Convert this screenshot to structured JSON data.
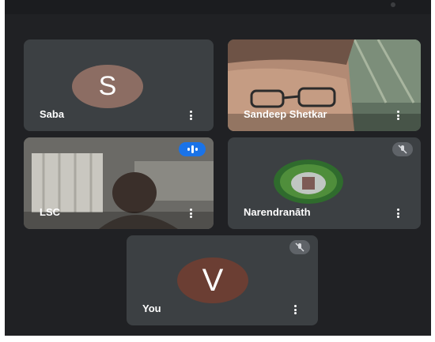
{
  "participants": [
    {
      "name": "Saba",
      "initial": "S",
      "avatar_color": "#8c6d63"
    },
    {
      "name": "Sandeep Shetkar",
      "initial": ""
    },
    {
      "name": "LSC",
      "initial": ""
    },
    {
      "name": "Narendranāth",
      "initial": ""
    },
    {
      "name": "You",
      "initial": "V",
      "avatar_color": "#6b3e33"
    }
  ],
  "colors": {
    "background": "#202124",
    "tile": "#3c4043",
    "speaking_indicator": "#1a73e8",
    "muted_indicator": "#5f6368"
  },
  "icons": {
    "more_options": "kebab-icon",
    "muted": "mic-off-icon",
    "speaking": "audio-wave-icon"
  }
}
